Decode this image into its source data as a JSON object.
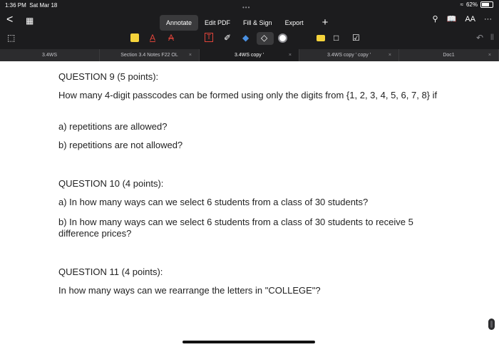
{
  "status": {
    "time": "1:36 PM",
    "date": "Sat Mar 18",
    "battery": "62%"
  },
  "nav": {
    "back": "<",
    "menu": [
      "Annotate",
      "Edit PDF",
      "Fill & Sign",
      "Export"
    ],
    "plus": "+",
    "aa": "AA",
    "more": "···"
  },
  "tools": {
    "text_a": "A",
    "strike_a": "A"
  },
  "tabs": [
    {
      "label": "3.4WS"
    },
    {
      "label": "Section 3.4 Notes F22 OL"
    },
    {
      "label": "3.4WS copy '"
    },
    {
      "label": "3.4WS copy ' copy '"
    },
    {
      "label": "Doc1"
    }
  ],
  "content": {
    "q9_title": "QUESTION 9 (5 points):",
    "q9_text": "How many 4-digit passcodes can be formed using only the digits from {1, 2, 3, 4, 5, 6, 7, 8} if",
    "q9_a": "a) repetitions are allowed?",
    "q9_b": "b) repetitions are not allowed?",
    "q10_title": "QUESTION 10 (4 points):",
    "q10_a": "a) In how many ways can we select 6 students from a class of 30 students?",
    "q10_b": "b) In how many ways can we select 6 students from a class of 30 students to receive 5 difference prices?",
    "q11_title": "QUESTION 11 (4 points):",
    "q11_text": "In how many ways can we rearrange the letters in \"COLLEGE\"?"
  },
  "colors": {
    "highlighter": "#f5d33b",
    "text_tool": "#e0443a",
    "strike_tool": "#e0443a",
    "marker": "#4a90e2"
  }
}
